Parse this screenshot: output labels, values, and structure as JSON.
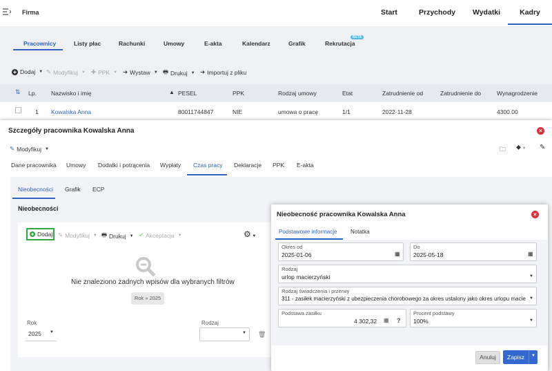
{
  "topbar": {
    "firm": "Firma",
    "nav": [
      "Start",
      "Przychody",
      "Wydatki",
      "Kadry"
    ]
  },
  "subtabs": [
    "Pracownicy",
    "Listy płac",
    "Rachunki",
    "Umowy",
    "E-akta",
    "Kalendarz",
    "Grafik",
    "Rekrutacja"
  ],
  "beta_badge": "BETA",
  "toolbar": {
    "add": "Dodaj",
    "modify": "Modyfikuj",
    "ppk": "PPK",
    "issue": "Wystaw",
    "print": "Drukuj",
    "import": "Importuj z pliku"
  },
  "table": {
    "headers": [
      "Lp.",
      "Nazwisko i imię",
      "PESEL",
      "PPK",
      "Rodzaj umowy",
      "Etat",
      "Zatrudnienie od",
      "Zatrudnienie do",
      "Wynagrodzenie"
    ],
    "rows": [
      [
        "1",
        "Kowalska Anna",
        "80011744847",
        "NIE",
        "umowa o pracę",
        "1/1",
        "2022-11-28",
        "",
        "4300.00"
      ]
    ]
  },
  "details": {
    "title": "Szczegóły pracownika Kowalska Anna",
    "modify": "Modyfikuj",
    "tabs": [
      "Dane pracownika",
      "Umowy",
      "Dodatki i potrącenia",
      "Wypłaty",
      "Czas pracy",
      "Deklaracje",
      "PPK",
      "E-akta"
    ],
    "subtabs": [
      "Nieobecności",
      "Grafik",
      "ECP"
    ],
    "section": "Nieobecności",
    "toolbar": {
      "add": "Dodaj",
      "modify": "Modyfikuj",
      "print": "Drukuj",
      "accept": "Akceptacja"
    },
    "empty_msg": "Nie znaleziono żadnych wpisów dla wybranych filtrów",
    "chip": "Rok » 2025",
    "filters": {
      "year_label": "Rok",
      "year_value": "2025",
      "type_label": "Rodzaj",
      "type_value": ""
    }
  },
  "absence": {
    "title": "Nieobecność pracownika Kowalska Anna",
    "tabs": [
      "Podstawowe informacje",
      "Notatka"
    ],
    "from_label": "Okres od",
    "from_value": "2025-01-06",
    "to_label": "Do",
    "to_value": "2025-05-18",
    "type_label": "Rodzaj",
    "type_value": "urlop macierzyński",
    "benefit_label": "Rodzaj świadczenia i przerwy",
    "benefit_value": "311 - zasiłek macierzyński z ubezpieczenia chorobowego za okres ustalony jako okres urlopu macie",
    "base_label": "Podstawa zasiłku",
    "base_value": "4 302,32",
    "pct_label": "Procent podstawy",
    "pct_value": "100%",
    "cancel": "Anuluj",
    "save": "Zapisz"
  },
  "colors": {
    "accent": "#2f62c0",
    "close": "#d9323b",
    "add_green": "#2fa744",
    "save_btn": "#3268cf"
  }
}
